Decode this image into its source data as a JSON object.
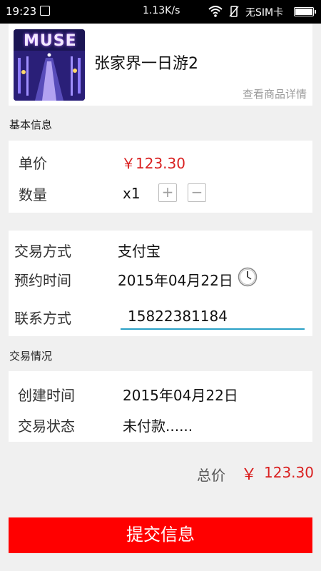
{
  "status_bar": {
    "time": "19:23",
    "speed": "1.13K/s",
    "carrier": "无SIM卡",
    "battery_level": 1.0
  },
  "product": {
    "thumbnail_text": "MUSE",
    "name": "张家界一日游2",
    "detail_link": "查看商品详情"
  },
  "basic_info": {
    "section_label": "基本信息",
    "price_label": "单价",
    "price_value": "￥123.30",
    "quantity_label": "数量",
    "quantity_value": "x1",
    "plus_symbol": "+",
    "minus_symbol": "−"
  },
  "payment": {
    "method_label": "交易方式",
    "method_value": "支付宝",
    "appointment_label": "预约时间",
    "appointment_value": "2015年04月22日",
    "contact_label": "联系方式",
    "contact_value": "15822381184"
  },
  "trade_status": {
    "section_label": "交易情况",
    "created_label": "创建时间",
    "created_value": "2015年04月22日",
    "status_label": "交易状态",
    "status_value": "未付款......"
  },
  "total": {
    "label": "总价",
    "currency": "￥",
    "value": "123.30"
  },
  "submit": {
    "label": "提交信息"
  },
  "colors": {
    "accent_red": "#d92020",
    "submit_bg": "#ff0000",
    "input_underline": "#2aa0c6"
  }
}
